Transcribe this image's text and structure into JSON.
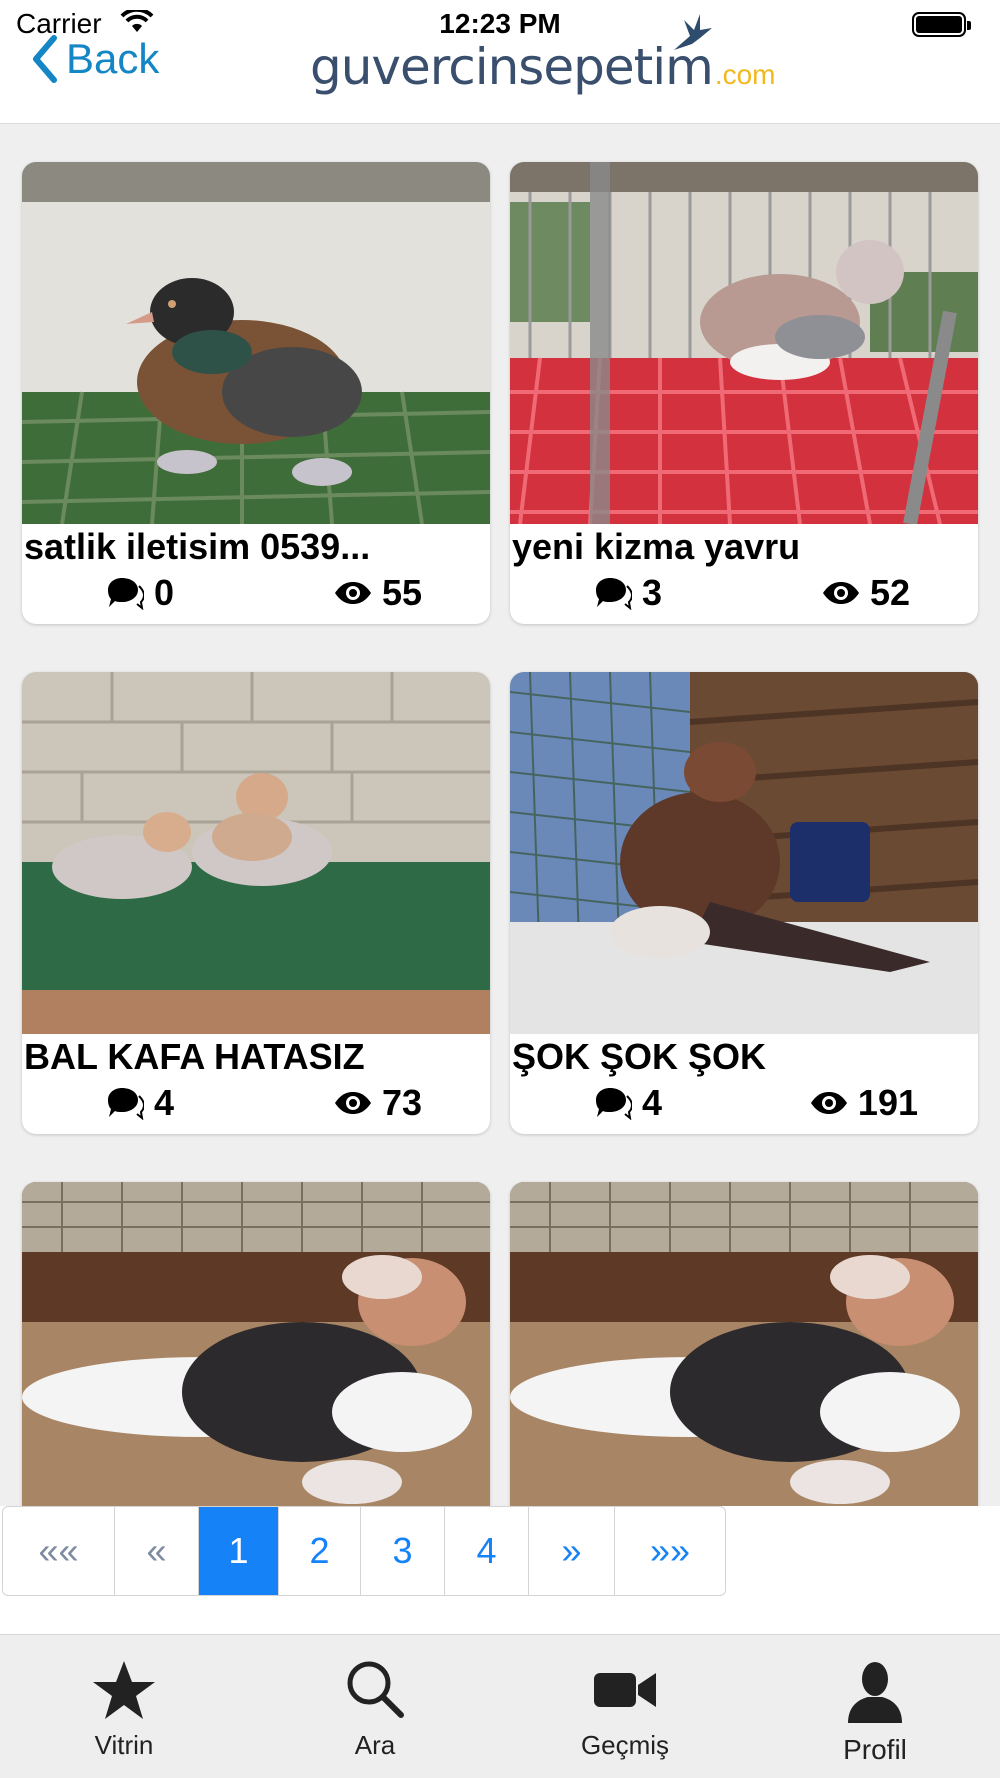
{
  "status_bar": {
    "carrier": "Carrier",
    "time": "12:23 PM"
  },
  "nav": {
    "back_label": "Back",
    "logo_text": "guvercinsepetim",
    "logo_tld": ".com"
  },
  "listings": [
    {
      "title": "satlik iletisim 0539...",
      "comments": "0",
      "views": "55"
    },
    {
      "title": "yeni kizma yavru",
      "comments": "3",
      "views": "52"
    },
    {
      "title": "BAL KAFA HATASIZ",
      "comments": "4",
      "views": "73"
    },
    {
      "title": "ŞOK ŞOK ŞOK",
      "comments": "4",
      "views": "191"
    }
  ],
  "pagination": {
    "first": "««",
    "prev": "«",
    "pages": [
      "1",
      "2",
      "3",
      "4"
    ],
    "active_page": "1",
    "next": "»",
    "last": "»»"
  },
  "tabs": {
    "vitrin": "Vitrin",
    "ara": "Ara",
    "gecmis": "Geçmiş",
    "profil": "Profil"
  },
  "colors": {
    "accent_blue": "#1583f7",
    "back_blue": "#1486c6",
    "logo_blue": "#3a4f6d",
    "logo_yellow": "#f2b81d"
  }
}
